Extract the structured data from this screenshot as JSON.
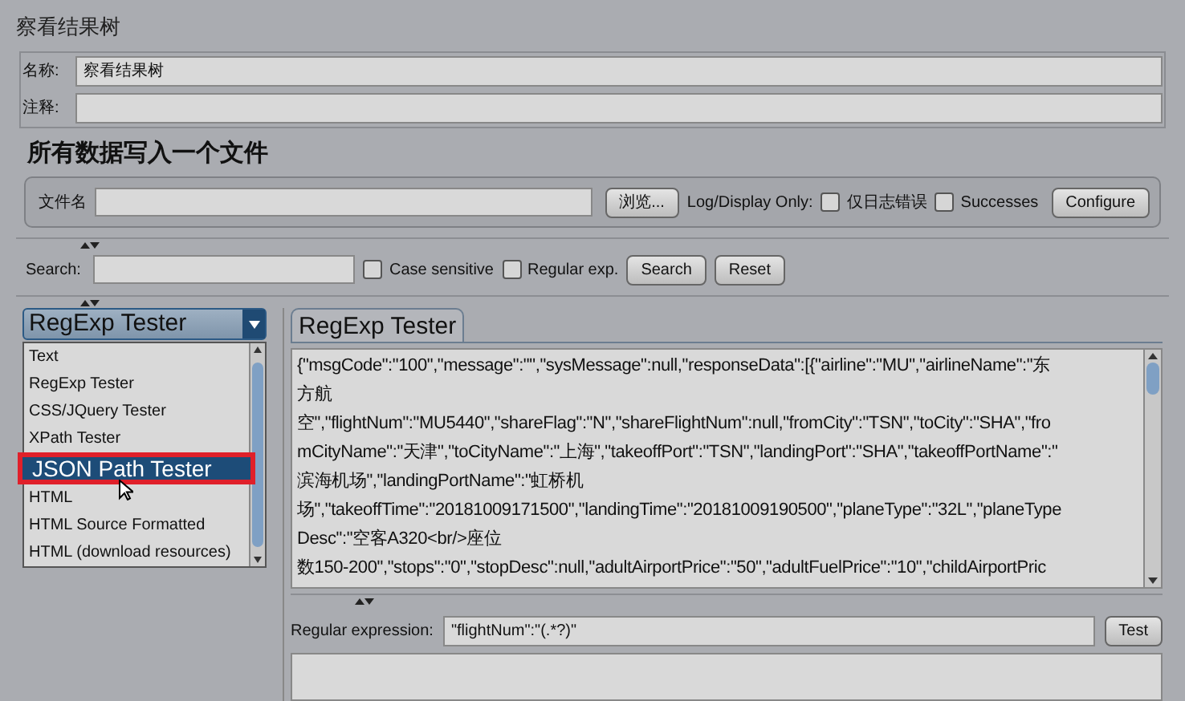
{
  "window": {
    "title": "察看结果树"
  },
  "name_field": {
    "label": "名称:",
    "value": "察看结果树"
  },
  "comment_field": {
    "label": "注释:"
  },
  "file_section": {
    "heading": "所有数据写入一个文件",
    "filename_label": "文件名",
    "browse_button": "浏览...",
    "log_label": "Log/Display Only:",
    "checkboxes": [
      {
        "label": "仅日志错误",
        "checked": false
      },
      {
        "label": "Successes",
        "checked": false
      }
    ],
    "configure_button": "Configure"
  },
  "search": {
    "label": "Search:",
    "checkboxes": [
      {
        "label": "Case sensitive",
        "checked": false
      },
      {
        "label": "Regular exp.",
        "checked": false
      }
    ],
    "search_button": "Search",
    "reset_button": "Reset"
  },
  "renderer_combo": {
    "value": "RegExp Tester",
    "options": [
      {
        "label": "Text",
        "highlighted": false
      },
      {
        "label": "RegExp Tester",
        "highlighted": false
      },
      {
        "label": "CSS/JQuery Tester",
        "highlighted": false
      },
      {
        "label": "XPath Tester",
        "highlighted": false
      },
      {
        "label": "JSON Path Tester",
        "highlighted": true
      },
      {
        "label": "HTML",
        "highlighted": false
      },
      {
        "label": "HTML Source Formatted",
        "highlighted": false
      },
      {
        "label": "HTML (download resources)",
        "highlighted": false
      }
    ]
  },
  "tabs": [
    {
      "label": "RegExp Tester",
      "selected": true
    }
  ],
  "response_lines": [
    "{\"msgCode\":\"100\",\"message\":\"\",\"sysMessage\":null,\"responseData\":[{\"airline\":\"MU\",\"airlineName\":\"东",
    "方航",
    "空\",\"flightNum\":\"MU5440\",\"shareFlag\":\"N\",\"shareFlightNum\":null,\"fromCity\":\"TSN\",\"toCity\":\"SHA\",\"fro",
    "mCityName\":\"天津\",\"toCityName\":\"上海\",\"takeoffPort\":\"TSN\",\"landingPort\":\"SHA\",\"takeoffPortName\":\"",
    "滨海机场\",\"landingPortName\":\"虹桥机",
    "场\",\"takeoffTime\":\"20181009171500\",\"landingTime\":\"20181009190500\",\"planeType\":\"32L\",\"planeType",
    "Desc\":\"空客A320<br/>座位",
    "数150-200\",\"stops\":\"0\",\"stopDesc\":null,\"adultAirportPrice\":\"50\",\"adultFuelPrice\":\"10\",\"childAirportPric"
  ],
  "regex": {
    "label": "Regular expression:",
    "value": "\"flightNum\":\"(.*?)\"",
    "test_button": "Test"
  }
}
